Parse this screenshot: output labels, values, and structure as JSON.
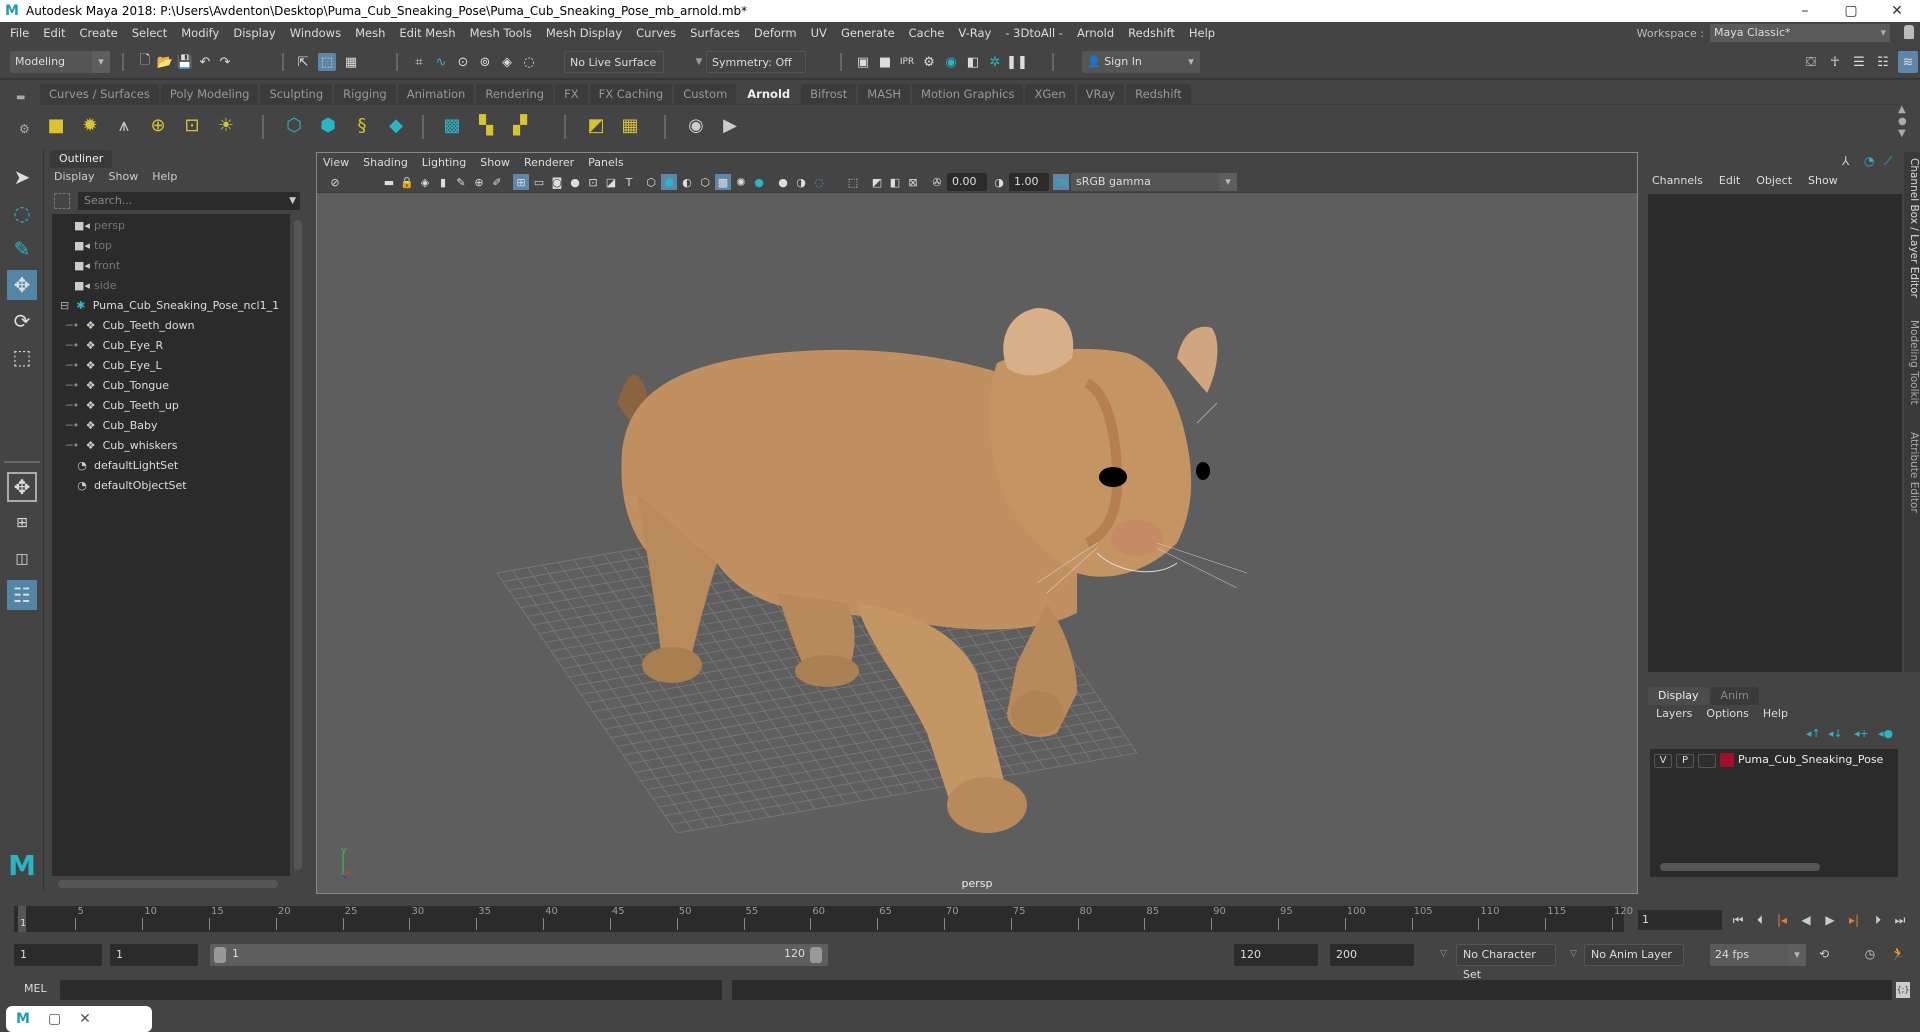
{
  "window": {
    "title": "Autodesk Maya 2018: P:\\Users\\Avdenton\\Desktop\\Puma_Cub_Sneaking_Pose\\Puma_Cub_Sneaking_Pose_mb_arnold.mb*",
    "controls": {
      "minimize": "–",
      "maximize": "▢",
      "close": "✕"
    }
  },
  "menubar": {
    "items": [
      "File",
      "Edit",
      "Create",
      "Select",
      "Modify",
      "Display",
      "Windows",
      "Mesh",
      "Edit Mesh",
      "Mesh Tools",
      "Mesh Display",
      "Curves",
      "Surfaces",
      "Deform",
      "UV",
      "Generate",
      "Cache",
      "V-Ray",
      "- 3DtoAll -",
      "Arnold",
      "Redshift",
      "Help"
    ],
    "workspace_label": "Workspace :",
    "workspace_value": "Maya Classic*"
  },
  "statusline": {
    "mode": "Modeling",
    "live_surface": "No Live Surface",
    "symmetry": "Symmetry: Off",
    "sign_in": "Sign In"
  },
  "shelf": {
    "tabs": [
      "Curves / Surfaces",
      "Poly Modeling",
      "Sculpting",
      "Rigging",
      "Animation",
      "Rendering",
      "FX",
      "FX Caching",
      "Custom",
      "Arnold",
      "Bifrost",
      "MASH",
      "Motion Graphics",
      "XGen",
      "VRay",
      "Redshift"
    ],
    "active_tab": "Arnold"
  },
  "outliner": {
    "tab": "Outliner",
    "menu": [
      "Display",
      "Show",
      "Help"
    ],
    "search_placeholder": "Search...",
    "items": [
      {
        "label": "persp",
        "type": "camera",
        "dim": true,
        "indent": 0
      },
      {
        "label": "top",
        "type": "camera",
        "dim": true,
        "indent": 0
      },
      {
        "label": "front",
        "type": "camera",
        "dim": true,
        "indent": 0
      },
      {
        "label": "side",
        "type": "camera",
        "dim": true,
        "indent": 0
      },
      {
        "label": "Puma_Cub_Sneaking_Pose_ncl1_1",
        "type": "group",
        "dim": false,
        "indent": 0,
        "expanded": true
      },
      {
        "label": "Cub_Teeth_down",
        "type": "mesh",
        "dim": false,
        "indent": 1
      },
      {
        "label": "Cub_Eye_R",
        "type": "mesh",
        "dim": false,
        "indent": 1
      },
      {
        "label": "Cub_Eye_L",
        "type": "mesh",
        "dim": false,
        "indent": 1
      },
      {
        "label": "Cub_Tongue",
        "type": "mesh",
        "dim": false,
        "indent": 1
      },
      {
        "label": "Cub_Teeth_up",
        "type": "mesh",
        "dim": false,
        "indent": 1
      },
      {
        "label": "Cub_Baby",
        "type": "mesh",
        "dim": false,
        "indent": 1
      },
      {
        "label": "Cub_whiskers",
        "type": "mesh",
        "dim": false,
        "indent": 1
      },
      {
        "label": "defaultLightSet",
        "type": "set",
        "dim": false,
        "indent": 0
      },
      {
        "label": "defaultObjectSet",
        "type": "set",
        "dim": false,
        "indent": 0
      }
    ]
  },
  "viewport": {
    "menu": [
      "View",
      "Shading",
      "Lighting",
      "Show",
      "Renderer",
      "Panels"
    ],
    "exposure": "0.00",
    "gamma": "1.00",
    "color_space": "sRGB gamma",
    "camera_label": "persp",
    "axis_label": "y"
  },
  "channelbox": {
    "menu": [
      "Channels",
      "Edit",
      "Object",
      "Show"
    ],
    "side_tabs": [
      "Channel Box / Layer Editor",
      "Modeling Toolkit",
      "Attribute Editor"
    ]
  },
  "layer_editor": {
    "tabs": [
      "Display",
      "Anim"
    ],
    "active_tab": "Display",
    "menu": [
      "Layers",
      "Options",
      "Help"
    ],
    "layers": [
      {
        "v": "V",
        "p": "P",
        "name": "Puma_Cub_Sneaking_Pose",
        "color": "#a0102a"
      }
    ]
  },
  "timeline": {
    "ticks": [
      5,
      10,
      15,
      20,
      25,
      30,
      35,
      40,
      45,
      50,
      55,
      60,
      65,
      70,
      75,
      80,
      85,
      90,
      95,
      100,
      105,
      110,
      115,
      120
    ],
    "start": 1,
    "end": 120,
    "current_marker": "1",
    "current_frame": "1"
  },
  "range": {
    "start_field": "1",
    "playback_start": "1",
    "slider_start": "1",
    "slider_end": "120",
    "playback_end": "120",
    "end_field": "200",
    "character_set": "No Character Set",
    "anim_layer": "No Anim Layer",
    "fps": "24 fps"
  },
  "cmdline": {
    "label": "MEL"
  },
  "colors": {
    "accent": "#5285a6",
    "layer": "#a0102a",
    "teal": "#29b5c5",
    "yellow": "#d8c430"
  }
}
